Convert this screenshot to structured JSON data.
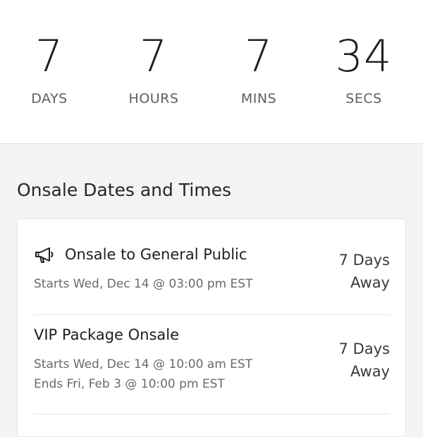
{
  "countdown": {
    "days": {
      "value": "7",
      "label": "DAYS"
    },
    "hours": {
      "value": "7",
      "label": "HOURS"
    },
    "mins": {
      "value": "7",
      "label": "MINS"
    },
    "secs": {
      "value": "34",
      "label": "SECS"
    }
  },
  "onsale": {
    "title": "Onsale Dates and Times",
    "items": [
      {
        "icon": "megaphone-icon",
        "title": "Onsale to General Public",
        "starts": "Starts Wed, Dec 14 @ 03:00 pm EST",
        "away_line1": "7 Days",
        "away_line2": "Away"
      },
      {
        "title": "VIP Package Onsale",
        "starts": "Starts Wed, Dec 14 @ 10:00 am EST",
        "ends": "Ends Fri, Feb 3 @ 10:00 pm EST",
        "away_line1": "7 Days",
        "away_line2": "Away"
      }
    ]
  }
}
